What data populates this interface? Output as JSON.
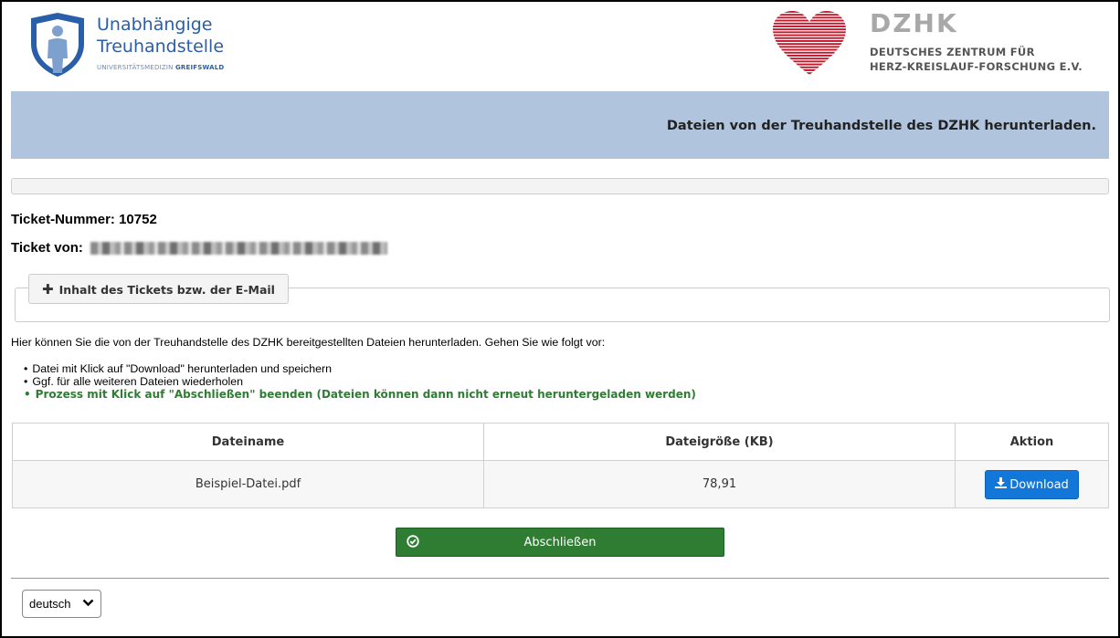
{
  "header": {
    "ttp_logo": {
      "line1": "Unabhängige",
      "line2": "Treuhandstelle",
      "sub_prefix": "UNIVERSITÄTSMEDIZIN ",
      "sub_bold": "GREIFSWALD"
    },
    "dzhk_logo": {
      "title": "DZHK",
      "line1": "DEUTSCHES ZENTRUM FÜR",
      "line2": "HERZ-KREISLAUF-FORSCHUNG E.V."
    }
  },
  "banner": {
    "title": "Dateien von der Treuhandstelle des DZHK herunterladen."
  },
  "ticket": {
    "number_label": "Ticket-Nummer: 10752",
    "from_label": "Ticket von:"
  },
  "ticket_content_button": {
    "label": "Inhalt des Tickets bzw. der E-Mail",
    "icon": "plus-icon"
  },
  "instructions": {
    "intro": "Hier können Sie die von der Treuhandstelle des DZHK bereitgestellten Dateien herunterladen. Gehen Sie wie folgt vor:",
    "steps": [
      "Datei mit Klick auf \"Download\" herunterladen und speichern",
      "Ggf. für alle weiteren Dateien wiederholen",
      "Prozess mit Klick auf \"Abschließen\" beenden (Dateien können dann nicht erneut heruntergeladen werden)"
    ]
  },
  "files_table": {
    "headers": [
      "Dateiname",
      "Dateigröße (KB)",
      "Aktion"
    ],
    "rows": [
      {
        "name": "Beispiel-Datei.pdf",
        "size": "78,91",
        "action": "Download"
      }
    ]
  },
  "finish_button": {
    "label": "Abschließen",
    "icon": "check-circle-icon"
  },
  "language_select": {
    "value": "deutsch",
    "icon": "chevron-down-icon"
  },
  "colors": {
    "banner": "#b0c4de",
    "primary": "#1277d8",
    "success": "#2e7d32",
    "ttp_blue": "#2a5ea8",
    "dzhk_red": "#c0182a"
  }
}
